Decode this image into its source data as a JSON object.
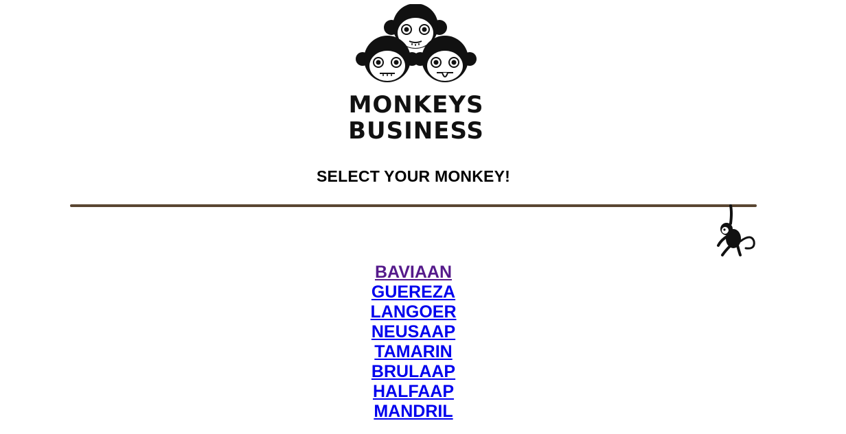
{
  "logo": {
    "line1": "MONKEYS",
    "line2": "BUSINESS"
  },
  "heading": "SELECT YOUR MONKEY!",
  "monkeys": [
    {
      "label": "BAVIAAN",
      "visited": true
    },
    {
      "label": "GUEREZA",
      "visited": false
    },
    {
      "label": "LANGOER",
      "visited": false
    },
    {
      "label": "NEUSAAP",
      "visited": false
    },
    {
      "label": "TAMARIN",
      "visited": false
    },
    {
      "label": "BRULAAP",
      "visited": false
    },
    {
      "label": "HALFAAP",
      "visited": false
    },
    {
      "label": "MANDRIL",
      "visited": false
    }
  ],
  "colors": {
    "link": "#0000ee",
    "visited_link": "#551a8b",
    "vine": "#5a4632"
  },
  "icons": {
    "logo": "three-monkeys-logo",
    "hanging": "hanging-monkey-icon"
  }
}
